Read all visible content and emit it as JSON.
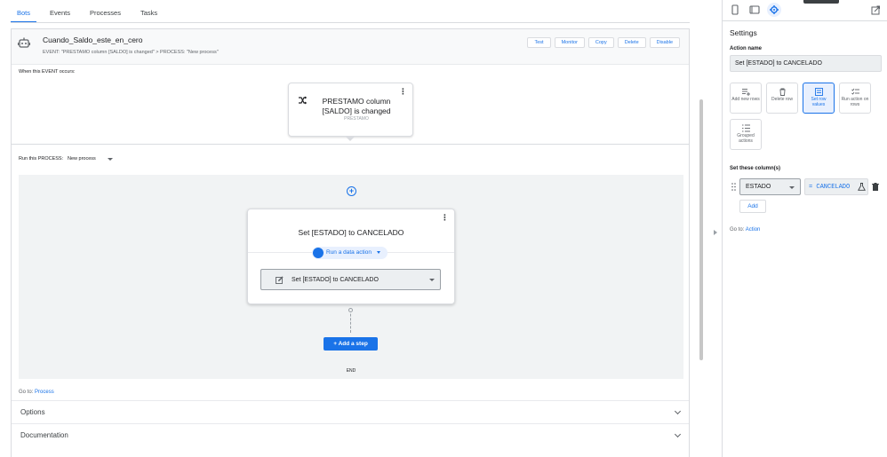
{
  "tabs": [
    {
      "label": "Bots",
      "active": true
    },
    {
      "label": "Events",
      "active": false
    },
    {
      "label": "Processes",
      "active": false
    },
    {
      "label": "Tasks",
      "active": false
    }
  ],
  "bot": {
    "name": "Cuando_Saldo_este_en_cero",
    "event_summary": "EVENT: \"PRESTAMO column [SALDO] is changed\" > PROCESS: \"New process\"",
    "buttons": [
      "Test",
      "Monitor",
      "Copy",
      "Delete",
      "Disable"
    ]
  },
  "event_section": {
    "label": "When this EVENT occurs:",
    "card_title": "PRESTAMO column [SALDO] is changed",
    "card_subtitle": "PRESTAMO"
  },
  "process_section": {
    "label": "Run this PROCESS:",
    "selected": "New process"
  },
  "step": {
    "title": "Set [ESTADO] to CANCELADO",
    "type_chip": "Run a data action",
    "action_select": "Set [ESTADO] to CANCELADO",
    "add_step_label": "+  Add a step",
    "end_label": "END"
  },
  "goto_main": {
    "prefix": "Go to:",
    "link": "Process"
  },
  "sections": [
    {
      "label": "Options"
    },
    {
      "label": "Documentation"
    }
  ],
  "settings": {
    "title": "Settings",
    "action_name_label": "Action name",
    "action_name_value": "Set [ESTADO] to CANCELADO",
    "action_types": [
      {
        "label": "Add new rows",
        "icon": "add-rows-icon",
        "selected": false
      },
      {
        "label": "Delete row",
        "icon": "delete-row-icon",
        "selected": false
      },
      {
        "label": "Set row values",
        "icon": "set-row-values-icon",
        "selected": true
      },
      {
        "label": "Run action on rows",
        "icon": "run-action-rows-icon",
        "selected": false
      },
      {
        "label": "Grouped actions",
        "icon": "grouped-actions-icon",
        "selected": false
      }
    ],
    "set_columns_label": "Set these column(s)",
    "column": "ESTADO",
    "value": "= CANCELADO",
    "add_label": "Add",
    "goto": {
      "prefix": "Go to:",
      "link": "Action"
    }
  },
  "colors": {
    "accent": "#1a73e8",
    "canvas_bg": "#f1f3f4",
    "selected_tile_bg": "#e8f0fe"
  }
}
